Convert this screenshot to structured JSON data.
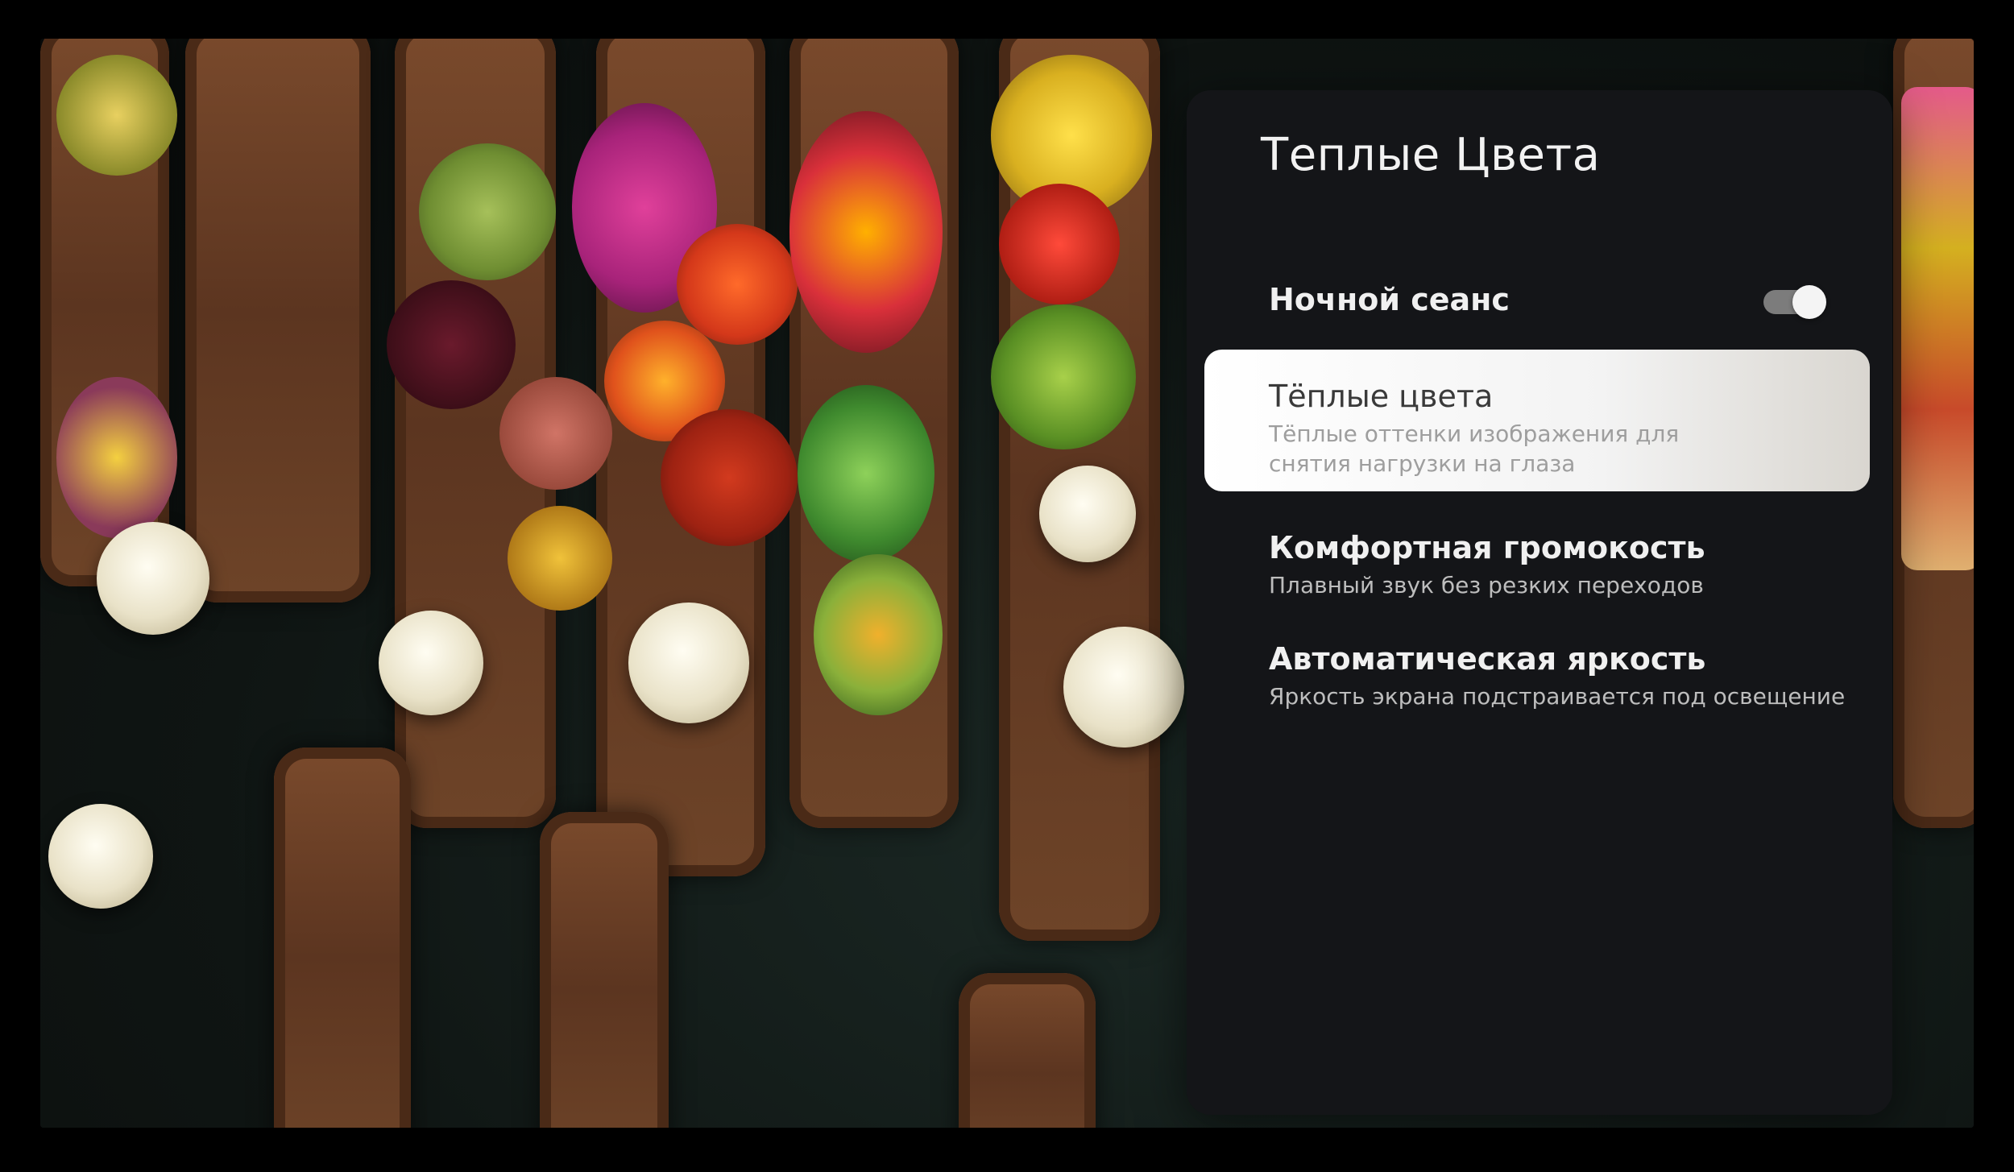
{
  "panel": {
    "title": "Теплые Цвета",
    "items": [
      {
        "label": "Ночной сеанс",
        "toggle": "on"
      },
      {
        "label": "Тёплые цвета",
        "description": "Тёплые оттенки изображения для снятия нагрузки на глаза",
        "state": "focused"
      },
      {
        "label": "Комфортная громокость",
        "description": "Плавный звук без резких переходов"
      },
      {
        "label": "Автоматическая яркость",
        "description": "Яркость экрана подстраивается под освещение"
      }
    ]
  },
  "colors": {
    "panel_bg": "#141518",
    "focused_row_bg": "#ffffff",
    "toggle_track": "#7c7c7c",
    "toggle_knob": "#f4f4f4",
    "text_primary": "#f0f0f0",
    "text_secondary": "#bdbdbd"
  },
  "icons": [
    "toggle-switch-icon"
  ]
}
